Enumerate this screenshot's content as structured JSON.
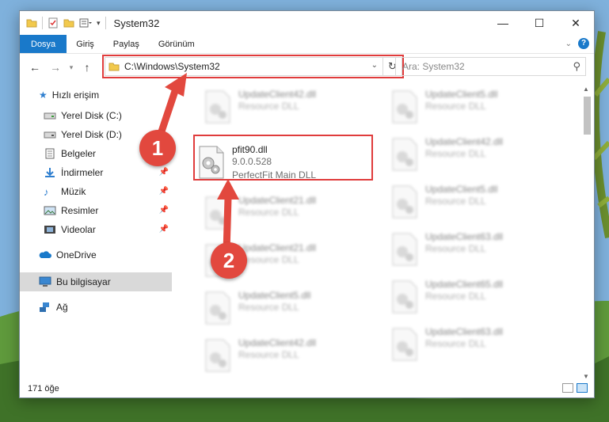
{
  "window": {
    "title": "System32",
    "controls": {
      "minimize": "—",
      "maximize": "☐",
      "close": "✕"
    }
  },
  "ribbon": {
    "tabs": [
      {
        "label": "Dosya",
        "active": true
      },
      {
        "label": "Giriş"
      },
      {
        "label": "Paylaş"
      },
      {
        "label": "Görünüm"
      }
    ],
    "help": "?"
  },
  "nav": {
    "address": "C:\\Windows\\System32",
    "search_placeholder": "Ara: System32"
  },
  "sidebar": {
    "items": [
      {
        "label": "Hızlı erişim",
        "icon": "star-icon"
      },
      {
        "label": "Yerel Disk (C:)",
        "icon": "drive-icon"
      },
      {
        "label": "Yerel Disk (D:)",
        "icon": "drive-icon"
      },
      {
        "label": "Belgeler",
        "icon": "documents-icon"
      },
      {
        "label": "İndirmeler",
        "icon": "downloads-icon"
      },
      {
        "label": "Müzik",
        "icon": "music-icon"
      },
      {
        "label": "Resimler",
        "icon": "pictures-icon"
      },
      {
        "label": "Videolar",
        "icon": "videos-icon"
      },
      {
        "label": "OneDrive",
        "icon": "cloud-icon"
      },
      {
        "label": "Bu bilgisayar",
        "icon": "computer-icon"
      },
      {
        "label": "Ağ",
        "icon": "network-icon"
      }
    ]
  },
  "files": {
    "highlighted": {
      "name": "pfit90.dll",
      "version": "9.0.0.528",
      "description": "PerfectFit Main DLL"
    },
    "left": [
      {
        "name": "UpdateClient42.dll",
        "type": "Resource DLL"
      },
      {
        "name": "UpdateClient21.dll",
        "type": "Resource DLL"
      },
      {
        "name": "UpdateClient21.dll",
        "type": "Resource DLL"
      },
      {
        "name": "UpdateClient5.dll",
        "type": "Resource DLL"
      },
      {
        "name": "UpdateClient42.dll",
        "type": "Resource DLL"
      }
    ],
    "right": [
      {
        "name": "UpdateClient5.dll",
        "type": "Resource DLL"
      },
      {
        "name": "UpdateClient42.dll",
        "type": "Resource DLL"
      },
      {
        "name": "UpdateClient5.dll",
        "type": "Resource DLL"
      },
      {
        "name": "UpdateClient63.dll",
        "type": "Resource DLL"
      },
      {
        "name": "UpdateClient65.dll",
        "type": "Resource DLL"
      },
      {
        "name": "UpdateClient63.dll",
        "type": "Resource DLL"
      }
    ]
  },
  "status": {
    "count": "171 öğe"
  },
  "annotations": {
    "step1": "1",
    "step2": "2"
  },
  "colors": {
    "accent": "#1979ca",
    "highlight": "#e03c3c",
    "badge": "#e2483e"
  }
}
